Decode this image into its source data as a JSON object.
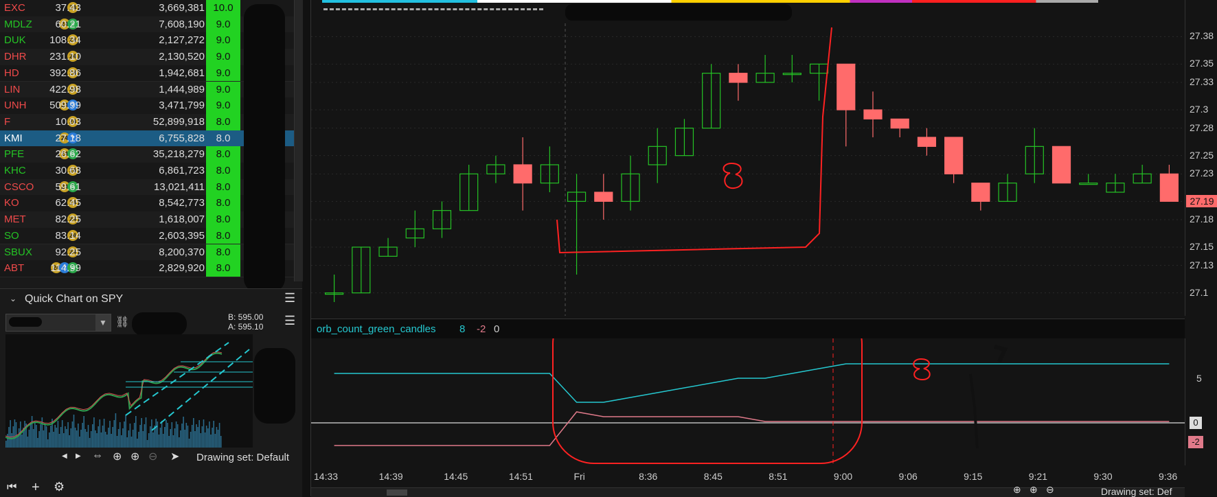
{
  "watchlist": {
    "rows": [
      {
        "symbol": "EXC",
        "sym_color": "#ef4a4a",
        "badges": [
          "24"
        ],
        "last": "37.43",
        "volume": "3,669,381",
        "score": "10.0"
      },
      {
        "symbol": "MDLZ",
        "sym_color": "#25c425",
        "badges": [
          "24",
          "green"
        ],
        "last": "60.21",
        "volume": "7,608,190",
        "score": "9.0"
      },
      {
        "symbol": "DUK",
        "sym_color": "#25c425",
        "badges": [
          "24"
        ],
        "last": "108.34",
        "volume": "2,127,272",
        "score": "9.0"
      },
      {
        "symbol": "DHR",
        "sym_color": "#ef4a4a",
        "badges": [
          "24"
        ],
        "last": "231.10",
        "volume": "2,130,520",
        "score": "9.0"
      },
      {
        "symbol": "HD",
        "sym_color": "#ef4a4a",
        "badges": [
          "24"
        ],
        "last": "392.86",
        "volume": "1,942,681",
        "score": "9.0"
      },
      {
        "symbol": "LIN",
        "sym_color": "#ef4a4a",
        "badges": [
          "24"
        ],
        "last": "422.98",
        "volume": "1,444,989",
        "score": "9.0"
      },
      {
        "symbol": "UNH",
        "sym_color": "#ef4a4a",
        "badges": [
          "24",
          "blue"
        ],
        "last": "509.99",
        "volume": "3,471,799",
        "score": "9.0"
      },
      {
        "symbol": "F",
        "sym_color": "#ef4a4a",
        "badges": [
          "24"
        ],
        "last": "10.03",
        "volume": "52,899,918",
        "score": "8.0"
      },
      {
        "symbol": "KMI",
        "sym_color": "#ffffff",
        "badges": [
          "24",
          "blue"
        ],
        "last": "27.18",
        "volume": "6,755,828",
        "score": "8.0",
        "selected": true
      },
      {
        "symbol": "PFE",
        "sym_color": "#25c425",
        "badges": [
          "24",
          "green"
        ],
        "last": "26.62",
        "volume": "35,218,279",
        "score": "8.0"
      },
      {
        "symbol": "KHC",
        "sym_color": "#25c425",
        "badges": [
          "24"
        ],
        "last": "30.68",
        "volume": "6,861,723",
        "score": "8.0"
      },
      {
        "symbol": "CSCO",
        "sym_color": "#ef4a4a",
        "badges": [
          "24",
          "green"
        ],
        "last": "59.61",
        "volume": "13,021,411",
        "score": "8.0"
      },
      {
        "symbol": "KO",
        "sym_color": "#ef4a4a",
        "badges": [
          "24"
        ],
        "last": "62.45",
        "volume": "8,542,773",
        "score": "8.0"
      },
      {
        "symbol": "MET",
        "sym_color": "#ef4a4a",
        "badges": [
          "24"
        ],
        "last": "82.25",
        "volume": "1,618,007",
        "score": "8.0"
      },
      {
        "symbol": "SO",
        "sym_color": "#25c425",
        "badges": [
          "24"
        ],
        "last": "83.14",
        "volume": "2,603,395",
        "score": "8.0"
      },
      {
        "symbol": "SBUX",
        "sym_color": "#25c425",
        "badges": [
          "24"
        ],
        "last": "92.25",
        "volume": "8,200,370",
        "score": "8.0"
      },
      {
        "symbol": "ABT",
        "sym_color": "#ef4a4a",
        "badges": [
          "24",
          "blue",
          "green"
        ],
        "last": "114.99",
        "volume": "2,829,920",
        "score": "8.0"
      }
    ]
  },
  "quick_chart": {
    "title": "Quick Chart on SPY",
    "bid": "B: 595.00",
    "ask": "A: 595.10",
    "drawing_set": "Drawing set: Default"
  },
  "main_chart": {
    "price_labels": [
      "27.38",
      "27.35",
      "27.33",
      "27.3",
      "27.28",
      "27.25",
      "27.23",
      "27.2",
      "27.18",
      "27.15",
      "27.13",
      "27.1"
    ],
    "current_price": "27.19",
    "time_labels": [
      "14:33",
      "14:39",
      "14:45",
      "14:51",
      "Fri",
      "8:36",
      "8:45",
      "8:51",
      "9:00",
      "9:06",
      "9:15",
      "9:21",
      "9:30",
      "9:36"
    ],
    "drawing_set": "Drawing set: Def"
  },
  "indicator": {
    "name": "orb_count_green_candles",
    "values": [
      "8",
      "-2",
      "0"
    ],
    "axis_labels": [
      "5",
      "0",
      "-2"
    ]
  },
  "colors": {
    "up": "#25c425",
    "down": "#ff6b6b",
    "cyan": "#25c8d0",
    "pink": "#e07a8a",
    "annotation": "#ff2222"
  },
  "chart_data": {
    "type": "candlestick",
    "ylim": [
      27.09,
      27.39
    ],
    "candles": [
      {
        "o": 27.1,
        "h": 27.12,
        "l": 27.09,
        "c": 27.1
      },
      {
        "o": 27.1,
        "h": 27.15,
        "l": 27.1,
        "c": 27.15
      },
      {
        "o": 27.14,
        "h": 27.16,
        "l": 27.14,
        "c": 27.15
      },
      {
        "o": 27.16,
        "h": 27.19,
        "l": 27.15,
        "c": 27.17
      },
      {
        "o": 27.17,
        "h": 27.2,
        "l": 27.16,
        "c": 27.19
      },
      {
        "o": 27.19,
        "h": 27.24,
        "l": 27.19,
        "c": 27.23
      },
      {
        "o": 27.23,
        "h": 27.25,
        "l": 27.22,
        "c": 27.24
      },
      {
        "o": 27.24,
        "h": 27.27,
        "l": 27.19,
        "c": 27.22
      },
      {
        "o": 27.22,
        "h": 27.26,
        "l": 27.21,
        "c": 27.24
      },
      {
        "o": 27.2,
        "h": 27.23,
        "l": 27.12,
        "c": 27.21
      },
      {
        "o": 27.21,
        "h": 27.23,
        "l": 27.18,
        "c": 27.2
      },
      {
        "o": 27.2,
        "h": 27.25,
        "l": 27.19,
        "c": 27.23
      },
      {
        "o": 27.24,
        "h": 27.28,
        "l": 27.22,
        "c": 27.26
      },
      {
        "o": 27.25,
        "h": 27.29,
        "l": 27.25,
        "c": 27.28
      },
      {
        "o": 27.28,
        "h": 27.35,
        "l": 27.28,
        "c": 27.34
      },
      {
        "o": 27.34,
        "h": 27.35,
        "l": 27.31,
        "c": 27.33
      },
      {
        "o": 27.33,
        "h": 27.36,
        "l": 27.33,
        "c": 27.34
      },
      {
        "o": 27.34,
        "h": 27.36,
        "l": 27.33,
        "c": 27.34
      },
      {
        "o": 27.34,
        "h": 27.35,
        "l": 27.31,
        "c": 27.35
      },
      {
        "o": 27.35,
        "h": 27.35,
        "l": 27.26,
        "c": 27.3
      },
      {
        "o": 27.3,
        "h": 27.32,
        "l": 27.27,
        "c": 27.29
      },
      {
        "o": 27.29,
        "h": 27.29,
        "l": 27.27,
        "c": 27.28
      },
      {
        "o": 27.27,
        "h": 27.28,
        "l": 27.25,
        "c": 27.26
      },
      {
        "o": 27.27,
        "h": 27.27,
        "l": 27.22,
        "c": 27.23
      },
      {
        "o": 27.22,
        "h": 27.22,
        "l": 27.19,
        "c": 27.2
      },
      {
        "o": 27.2,
        "h": 27.23,
        "l": 27.2,
        "c": 27.22
      },
      {
        "o": 27.23,
        "h": 27.28,
        "l": 27.22,
        "c": 27.26
      },
      {
        "o": 27.26,
        "h": 27.26,
        "l": 27.22,
        "c": 27.22
      },
      {
        "o": 27.22,
        "h": 27.23,
        "l": 27.22,
        "c": 27.22
      },
      {
        "o": 27.21,
        "h": 27.23,
        "l": 27.21,
        "c": 27.22
      },
      {
        "o": 27.22,
        "h": 27.24,
        "l": 27.22,
        "c": 27.23
      },
      {
        "o": 27.23,
        "h": 27.24,
        "l": 27.21,
        "c": 27.2
      }
    ],
    "indicator_green": [
      8,
      8,
      8,
      8,
      8,
      8,
      8,
      8,
      8,
      2,
      2,
      3,
      4,
      5,
      6,
      7,
      7,
      8,
      9,
      10,
      10,
      10,
      10,
      10,
      10,
      10,
      10,
      10,
      10,
      10,
      10,
      10
    ],
    "indicator_red": [
      -7,
      -7,
      -7,
      -7,
      -7,
      -7,
      -7,
      -7,
      -7,
      0,
      -1,
      -1,
      -1,
      -1,
      -1,
      -1,
      -2,
      -2,
      -2,
      -2,
      -2,
      -2,
      -2,
      -2,
      -2,
      -2,
      -2,
      -2,
      -2,
      -2,
      -2,
      -2
    ],
    "indicator_zero": 0
  }
}
